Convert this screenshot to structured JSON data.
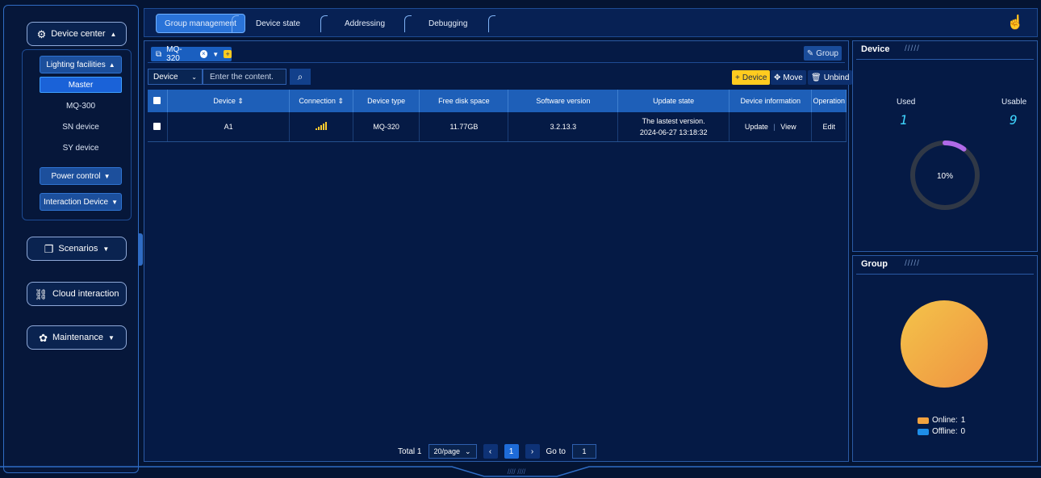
{
  "sidebar": {
    "device_center": "Device center",
    "lighting_facilities": "Lighting facilities",
    "items": [
      {
        "label": "Master",
        "active": true
      },
      {
        "label": "MQ-300",
        "active": false
      },
      {
        "label": "SN device",
        "active": false
      },
      {
        "label": "SY device",
        "active": false
      }
    ],
    "power_control": "Power control",
    "interaction_device": "Interaction Device",
    "scenarios": "Scenarios",
    "cloud_interaction": "Cloud interaction",
    "maintenance": "Maintenance"
  },
  "tabs": [
    "Group management",
    "Device state",
    "Addressing",
    "Debugging"
  ],
  "main": {
    "group_name": "MQ-320",
    "group_button": "Group",
    "filter_select": "Device",
    "search_placeholder": "Enter the content.",
    "actions": {
      "add_device": "Device",
      "move": "Move",
      "unbind": "Unbind"
    },
    "columns": [
      "Device",
      "Connection",
      "Device type",
      "Free disk space",
      "Software version",
      "Update state",
      "Device information",
      "Operation"
    ],
    "rows": [
      {
        "device": "A1",
        "device_type": "MQ-320",
        "free_disk": "11.77GB",
        "software_version": "3.2.13.3",
        "update_state_line1": "The lastest version.",
        "update_state_line2": "2024-06-27 13:18:32",
        "update_label": "Update",
        "view_label": "View",
        "edit_label": "Edit"
      }
    ],
    "pager": {
      "total": "Total 1",
      "page_size": "20/page",
      "current_page": "1",
      "goto_label": "Go to",
      "goto_value": "1"
    }
  },
  "device_panel": {
    "title": "Device",
    "used_label": "Used",
    "usable_label": "Usable",
    "used_value": "1",
    "usable_value": "9",
    "percent_label": "10%",
    "percent": 0.1
  },
  "group_panel": {
    "title": "Group",
    "online_label": "Online:",
    "online_value": "1",
    "offline_label": "Offline:",
    "offline_value": "0",
    "online_color": "#f2a23e",
    "offline_color": "#1e8ee8"
  }
}
